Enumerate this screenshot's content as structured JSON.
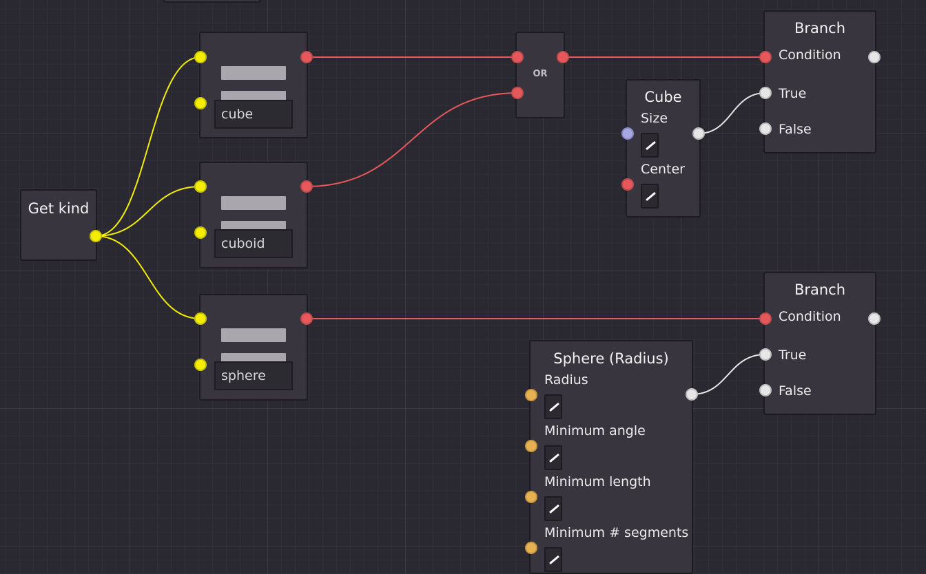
{
  "nodes": {
    "get_kind": {
      "title": "Get kind"
    },
    "compare_1": {
      "value": "cube"
    },
    "compare_2": {
      "value": "cuboid"
    },
    "compare_3": {
      "value": "sphere"
    },
    "or_node": {
      "label": "OR"
    },
    "cube": {
      "title": "Cube",
      "size_label": "Size",
      "center_label": "Center"
    },
    "branch_1": {
      "title": "Branch",
      "condition_label": "Condition",
      "true_label": "True",
      "false_label": "False"
    },
    "branch_2": {
      "title": "Branch",
      "condition_label": "Condition",
      "true_label": "True",
      "false_label": "False"
    },
    "sphere": {
      "title": "Sphere (Radius)",
      "radius_label": "Radius",
      "min_angle_label": "Minimum angle",
      "min_length_label": "Minimum length",
      "min_segments_label": "Minimum # segments"
    }
  },
  "colors": {
    "background": "#2a2830",
    "node": "#38353e",
    "wire_kind": "#f3ee00",
    "wire_bool": "#e5595c",
    "wire_geometry": "#e6e6e6",
    "pin_vector": "#a8a8e0",
    "pin_number": "#e6b152"
  },
  "icons": {
    "edit": "pencil-icon"
  }
}
